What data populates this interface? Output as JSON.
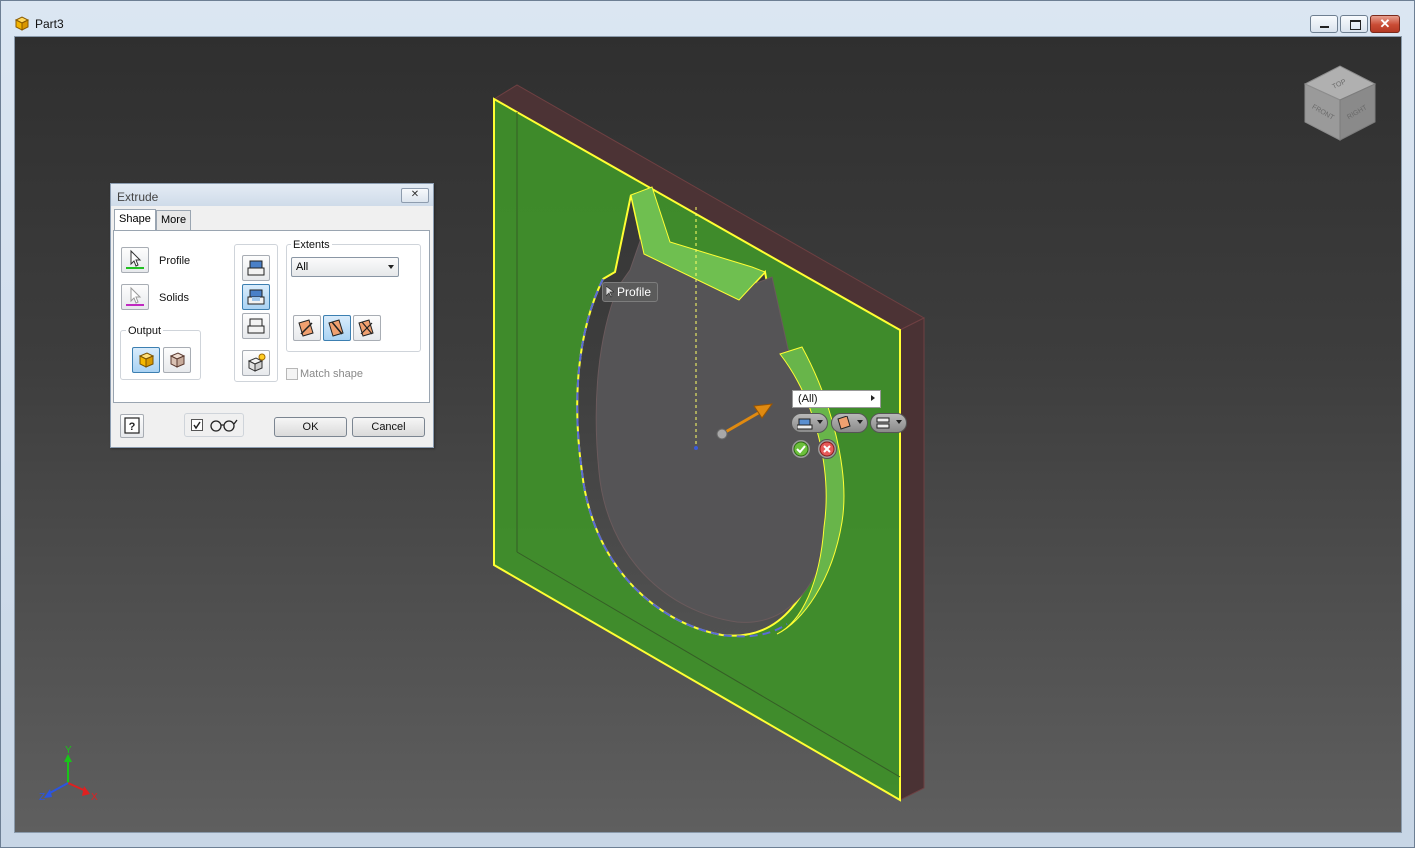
{
  "window": {
    "title": "Part3"
  },
  "dialog": {
    "title": "Extrude",
    "tabs": [
      {
        "label": "Shape"
      },
      {
        "label": "More"
      }
    ],
    "profile_label": "Profile",
    "solids_label": "Solids",
    "output_label": "Output",
    "extents_label": "Extents",
    "extents_value": "All",
    "match_shape_label": "Match shape",
    "ok_label": "OK",
    "cancel_label": "Cancel"
  },
  "viewport": {
    "profile_tooltip": "Profile",
    "mini_toolbar_value": "(All)",
    "viewcube": {
      "top": "TOP",
      "front": "FRONT",
      "right": "RIGHT"
    },
    "triad": {
      "x": "X",
      "y": "Y",
      "z": "Z"
    }
  },
  "colors": {
    "face_green": "#3f8f2a",
    "edge_yellow": "#ffff33",
    "annotation_red": "#e01010"
  },
  "icons": {
    "app": "part-cube-icon",
    "profile": "select-arrow-icon",
    "solids": "select-arrow-icon",
    "output_solid": "solid-cube-icon",
    "output_surface": "surface-cube-icon",
    "join": "join-operation-icon",
    "cut": "cut-operation-icon",
    "intersect": "intersect-operation-icon",
    "new_solid": "new-solid-icon",
    "help": "help-icon",
    "preview": "glasses-icon"
  }
}
